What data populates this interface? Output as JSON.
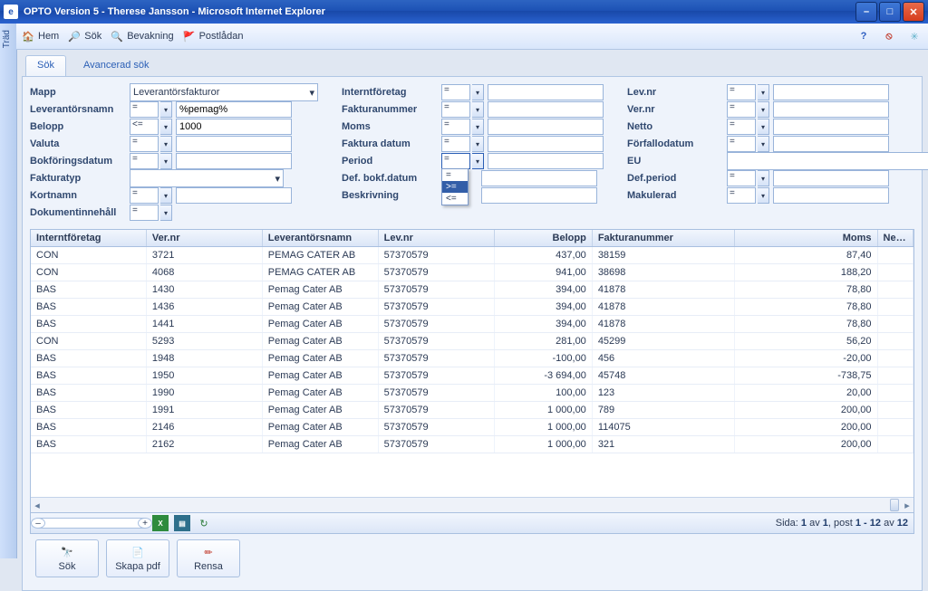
{
  "window": {
    "title": "OPTO Version 5 - Therese Jansson - Microsoft Internet Explorer",
    "appicon_text": "e"
  },
  "sidebar": {
    "label": "Träd"
  },
  "toolbar": {
    "home": "Hem",
    "search": "Sök",
    "watch": "Bevakning",
    "mailbox": "Postlådan"
  },
  "tabs": {
    "search": "Sök",
    "advanced": "Avancerad sök"
  },
  "form": {
    "col1": {
      "mapp": {
        "label": "Mapp",
        "value": "Leverantörsfakturor"
      },
      "leverantorsnamn": {
        "label": "Leverantörsnamn",
        "op": "=",
        "value": "%pemag%"
      },
      "belopp": {
        "label": "Belopp",
        "op": "<=",
        "value": "1000"
      },
      "valuta": {
        "label": "Valuta",
        "op": "="
      },
      "bokforingsdatum": {
        "label": "Bokföringsdatum",
        "op": "="
      },
      "fakturatyp": {
        "label": "Fakturatyp"
      },
      "kortnamn": {
        "label": "Kortnamn",
        "op": "="
      },
      "dokumentinnehall": {
        "label": "Dokumentinnehåll",
        "op": "="
      }
    },
    "col2": {
      "interntforetag": {
        "label": "Interntföretag",
        "op": "="
      },
      "fakturanummer": {
        "label": "Fakturanummer",
        "op": "="
      },
      "moms": {
        "label": "Moms",
        "op": "="
      },
      "fakturadatum": {
        "label": "Faktura datum",
        "op": "="
      },
      "period": {
        "label": "Period",
        "op": "=",
        "options": [
          "=",
          ">=",
          "<="
        ],
        "selected_in_drop": ">="
      },
      "defbokfdatum": {
        "label": "Def. bokf.datum"
      },
      "beskrivning": {
        "label": "Beskrivning"
      }
    },
    "col3": {
      "levnr": {
        "label": "Lev.nr",
        "op": "="
      },
      "vernr": {
        "label": "Ver.nr",
        "op": "="
      },
      "netto": {
        "label": "Netto",
        "op": "="
      },
      "forfallodatum": {
        "label": "Förfallodatum",
        "op": "="
      },
      "eu": {
        "label": "EU"
      },
      "defperiod": {
        "label": "Def.period",
        "op": "="
      },
      "makulerad": {
        "label": "Makulerad",
        "op": "="
      }
    }
  },
  "grid": {
    "headers": [
      "Interntföretag",
      "Ver.nr",
      "Leverantörsnamn",
      "Lev.nr",
      "Belopp",
      "Fakturanummer",
      "Moms",
      "Netto"
    ],
    "rows": [
      {
        "c": [
          "CON",
          "3721",
          "PEMAG CATER AB",
          "57370579",
          "437,00",
          "38159",
          "87,40",
          ""
        ]
      },
      {
        "c": [
          "CON",
          "4068",
          "PEMAG CATER AB",
          "57370579",
          "941,00",
          "38698",
          "188,20",
          ""
        ]
      },
      {
        "c": [
          "BAS",
          "1430",
          "Pemag Cater AB",
          "57370579",
          "394,00",
          "41878",
          "78,80",
          ""
        ]
      },
      {
        "c": [
          "BAS",
          "1436",
          "Pemag Cater AB",
          "57370579",
          "394,00",
          "41878",
          "78,80",
          ""
        ]
      },
      {
        "c": [
          "BAS",
          "1441",
          "Pemag Cater AB",
          "57370579",
          "394,00",
          "41878",
          "78,80",
          ""
        ]
      },
      {
        "c": [
          "CON",
          "5293",
          "Pemag Cater AB",
          "57370579",
          "281,00",
          "45299",
          "56,20",
          ""
        ]
      },
      {
        "c": [
          "BAS",
          "1948",
          "Pemag Cater AB",
          "57370579",
          "-100,00",
          "456",
          "-20,00",
          ""
        ]
      },
      {
        "c": [
          "BAS",
          "1950",
          "Pemag Cater AB",
          "57370579",
          "-3 694,00",
          "45748",
          "-738,75",
          ""
        ]
      },
      {
        "c": [
          "BAS",
          "1990",
          "Pemag Cater AB",
          "57370579",
          "100,00",
          "123",
          "20,00",
          ""
        ]
      },
      {
        "c": [
          "BAS",
          "1991",
          "Pemag Cater AB",
          "57370579",
          "1 000,00",
          "789",
          "200,00",
          ""
        ]
      },
      {
        "c": [
          "BAS",
          "2146",
          "Pemag Cater AB",
          "57370579",
          "1 000,00",
          "114075",
          "200,00",
          ""
        ]
      },
      {
        "c": [
          "BAS",
          "2162",
          "Pemag Cater AB",
          "57370579",
          "1 000,00",
          "321",
          "200,00",
          ""
        ]
      }
    ]
  },
  "pager": {
    "prefix": "Sida: ",
    "page_cur": "1",
    "page_of": " av ",
    "page_tot": "1",
    "posts": ", post ",
    "range": "1 - 12",
    "of2": " av ",
    "total": "12"
  },
  "buttons": {
    "sok": "Sök",
    "pdf": "Skapa pdf",
    "rensa": "Rensa"
  }
}
